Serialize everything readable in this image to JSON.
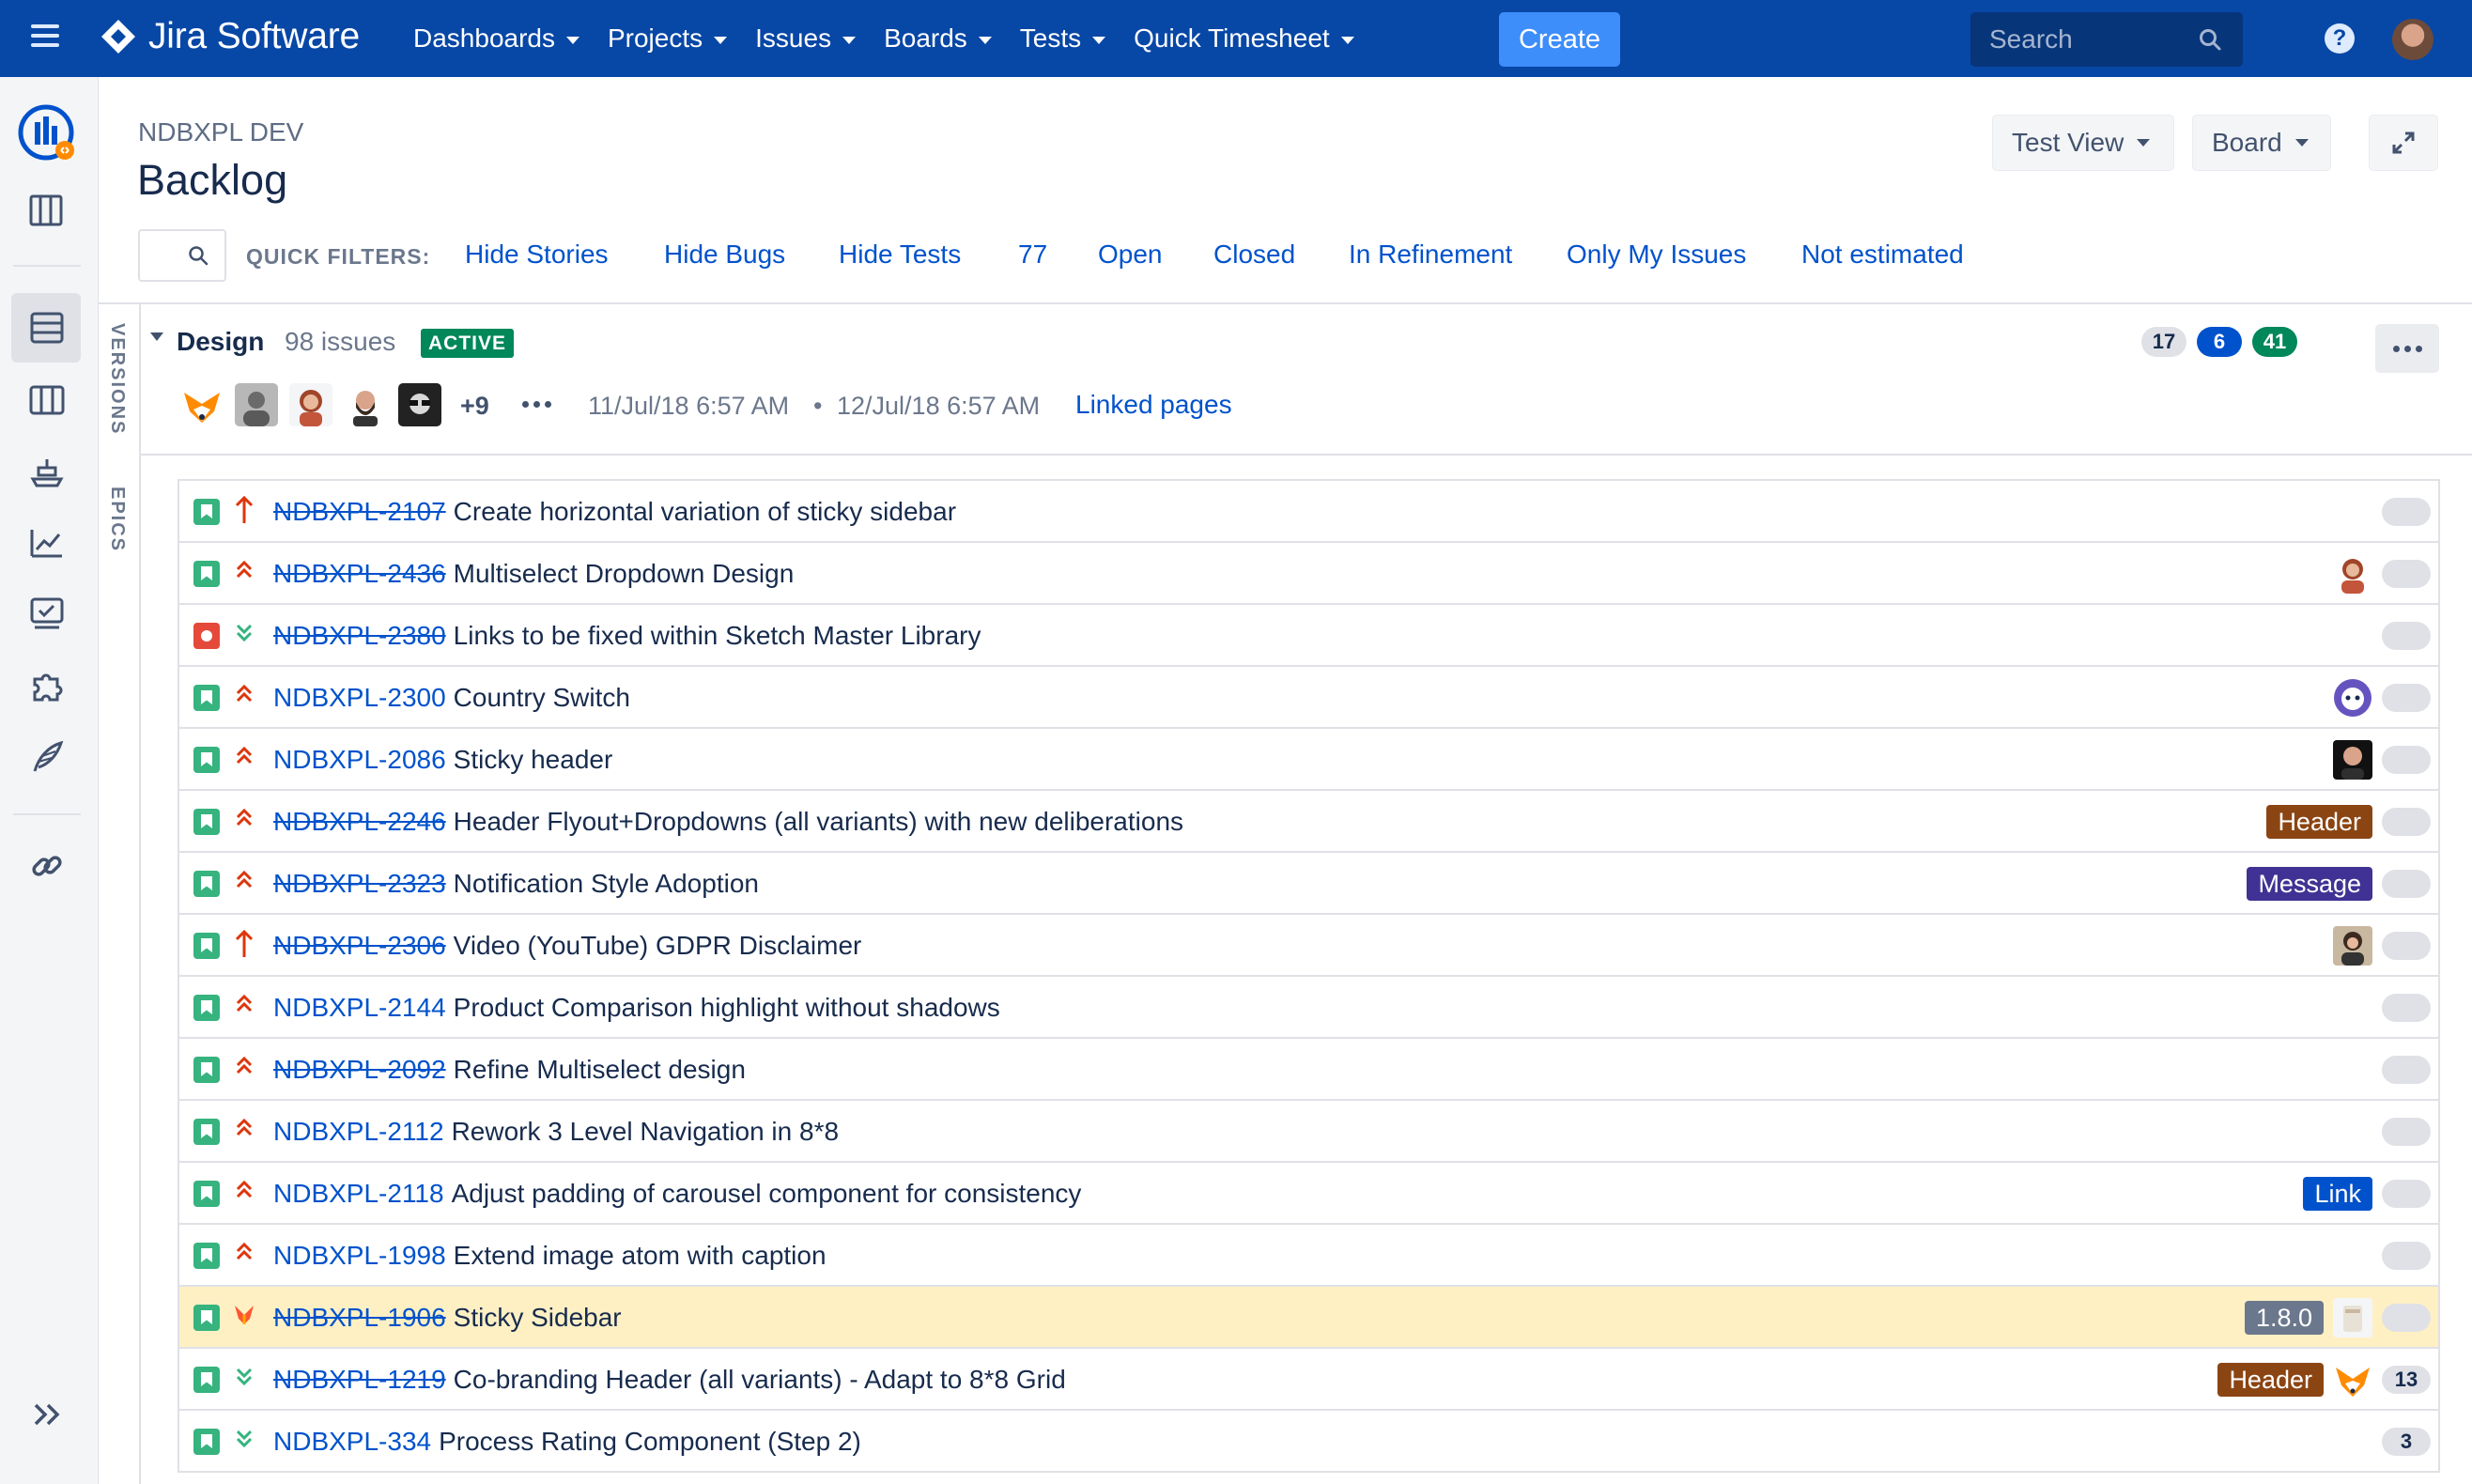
{
  "topnav": {
    "logo_text": "Jira Software",
    "menu": [
      {
        "label": "Dashboards"
      },
      {
        "label": "Projects"
      },
      {
        "label": "Issues"
      },
      {
        "label": "Boards"
      },
      {
        "label": "Tests"
      },
      {
        "label": "Quick Timesheet"
      }
    ],
    "create_label": "Create",
    "search_placeholder": "Search",
    "help_icon": "?"
  },
  "header": {
    "project_name": "NDBXPL DEV",
    "title": "Backlog",
    "test_view_label": "Test View",
    "board_label": "Board"
  },
  "quick_filters": {
    "label": "QUICK FILTERS:",
    "items": [
      "Hide Stories",
      "Hide Bugs",
      "Hide Tests",
      "77",
      "Open",
      "Closed",
      "In Refinement",
      "Only My Issues",
      "Not estimated"
    ]
  },
  "vertical_tabs": {
    "versions": "VERSIONS",
    "epics": "EPICS"
  },
  "sprint": {
    "name": "Design",
    "issue_count": "98 issues",
    "status": "ACTIVE",
    "counts": {
      "todo": "17",
      "in_progress": "6",
      "done": "41"
    },
    "more_avatars": "+9",
    "start": "11/Jul/18 6:57 AM",
    "separator": "•",
    "end": "12/Jul/18 6:57 AM",
    "linked_pages": "Linked pages"
  },
  "colors": {
    "nav_bg": "#0747a6",
    "create": "#3d8dfb",
    "link": "#0052cc",
    "story": "#36b37e",
    "bug": "#e5493a",
    "active": "#00875a",
    "label_header": "#8b4513",
    "label_message": "#403294",
    "label_link": "#0052cc",
    "label_version": "#6b778c",
    "selected_row": "#fff0c4"
  },
  "issues": [
    {
      "key": "NDBXPL-2107",
      "summary": "Create horizontal variation of sticky sidebar",
      "type": "story",
      "priority": "highest-arrow",
      "done": true
    },
    {
      "key": "NDBXPL-2436",
      "summary": "Multiselect Dropdown Design",
      "type": "story",
      "priority": "high-chevrons",
      "done": true,
      "avatar": "woman"
    },
    {
      "key": "NDBXPL-2380",
      "summary": "Links to be fixed within Sketch Master Library",
      "type": "bug",
      "priority": "low-chevrons",
      "done": true
    },
    {
      "key": "NDBXPL-2300",
      "summary": "Country Switch",
      "type": "story",
      "priority": "high-chevrons",
      "done": false,
      "avatar": "robot"
    },
    {
      "key": "NDBXPL-2086",
      "summary": "Sticky header",
      "type": "story",
      "priority": "high-chevrons",
      "done": false,
      "avatar": "man"
    },
    {
      "key": "NDBXPL-2246",
      "summary": "Header Flyout+Dropdowns (all variants) with new deliberations",
      "type": "story",
      "priority": "high-chevrons",
      "done": true,
      "label": "Header",
      "label_color": "#8b4513"
    },
    {
      "key": "NDBXPL-2323",
      "summary": "Notification Style Adoption",
      "type": "story",
      "priority": "high-chevrons",
      "done": true,
      "label": "Message",
      "label_color": "#403294"
    },
    {
      "key": "NDBXPL-2306",
      "summary": "Video (YouTube) GDPR Disclaimer",
      "type": "story",
      "priority": "highest-arrow",
      "done": true,
      "avatar": "woman2"
    },
    {
      "key": "NDBXPL-2144",
      "summary": "Product Comparison highlight without shadows",
      "type": "story",
      "priority": "high-chevrons",
      "done": false
    },
    {
      "key": "NDBXPL-2092",
      "summary": "Refine Multiselect design",
      "type": "story",
      "priority": "high-chevrons",
      "done": true
    },
    {
      "key": "NDBXPL-2112",
      "summary": "Rework 3 Level Navigation in 8*8",
      "type": "story",
      "priority": "high-chevrons",
      "done": false
    },
    {
      "key": "NDBXPL-2118",
      "summary": "Adjust padding of carousel component for consistency",
      "type": "story",
      "priority": "high-chevrons",
      "done": false,
      "label": "Link",
      "label_color": "#0052cc"
    },
    {
      "key": "NDBXPL-1998",
      "summary": "Extend image atom with caption",
      "type": "story",
      "priority": "high-chevrons",
      "done": false
    },
    {
      "key": "NDBXPL-1906",
      "summary": "Sticky Sidebar",
      "type": "story",
      "priority": "flag",
      "done": true,
      "selected": true,
      "label": "1.8.0",
      "label_color": "#6b778c",
      "avatar": "cup"
    },
    {
      "key": "NDBXPL-1219",
      "summary": "Co-branding Header (all variants) - Adapt to 8*8 Grid",
      "type": "story",
      "priority": "low-chevrons",
      "done": true,
      "label": "Header",
      "label_color": "#8b4513",
      "avatar": "fox",
      "estimate": "13"
    },
    {
      "key": "NDBXPL-334",
      "summary": "Process Rating Component (Step 2)",
      "type": "story",
      "priority": "low-chevrons",
      "done": false,
      "estimate": "3"
    }
  ]
}
